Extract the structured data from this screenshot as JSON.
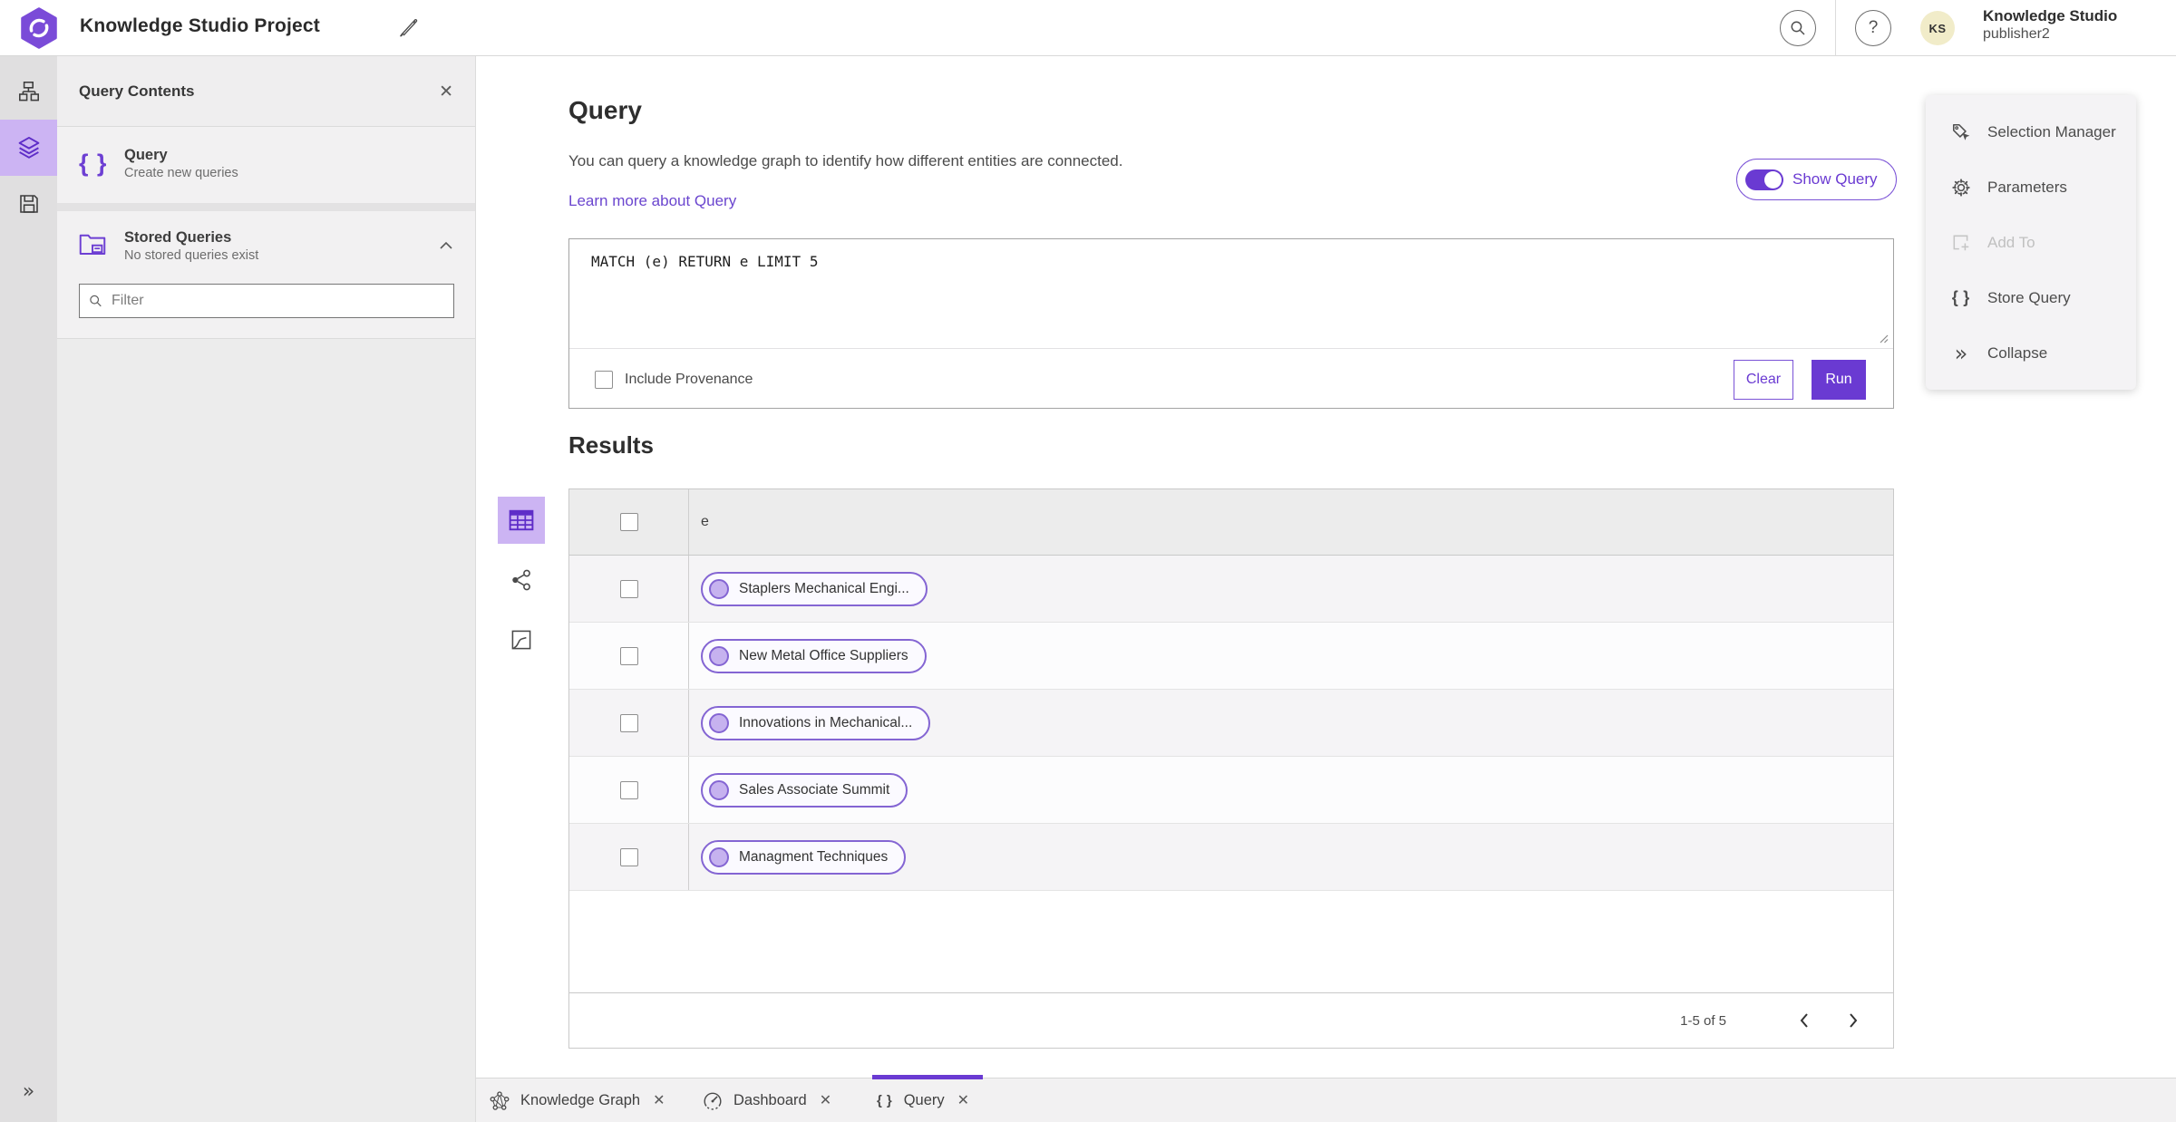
{
  "header": {
    "title": "Knowledge Studio Project",
    "user_name": "Knowledge Studio",
    "user_role": "publisher2",
    "avatar_initials": "KS"
  },
  "rail_icons": [
    "data-model-icon",
    "layers-icon",
    "save-icon",
    "expand-icon"
  ],
  "sidebar": {
    "title": "Query Contents",
    "close_icon": "close-icon",
    "items": [
      {
        "label": "Query",
        "description": "Create new queries",
        "icon": "braces-icon"
      },
      {
        "label": "Stored Queries",
        "description": "No stored queries exist",
        "icon": "stored-folder-icon"
      }
    ],
    "filter_placeholder": "Filter"
  },
  "query": {
    "heading": "Query",
    "description": "You can query a knowledge graph to identify how different entities are connected.",
    "learn_more": "Learn more about Query",
    "show_query_label": "Show Query",
    "show_query_on": true,
    "query_text": "MATCH (e) RETURN e LIMIT 5",
    "include_provenance_label": "Include Provenance",
    "clear_label": "Clear",
    "run_label": "Run"
  },
  "results": {
    "heading": "Results",
    "column_header": "e",
    "view_icons": [
      "table-view-icon",
      "link-chart-view-icon",
      "map-view-icon"
    ],
    "rows": [
      "Staplers Mechanical Engi...",
      "New Metal Office Suppliers",
      "Innovations in Mechanical...",
      "Sales Associate Summit",
      "Managment Techniques"
    ],
    "pagination": {
      "label": "1-5 of 5",
      "prev_icon": "chevron-left-icon",
      "next_icon": "chevron-right-icon"
    }
  },
  "tools_panel": {
    "items": [
      {
        "label": "Selection Manager",
        "icon": "selection-manager-icon",
        "disabled": false
      },
      {
        "label": "Parameters",
        "icon": "gear-icon",
        "disabled": false
      },
      {
        "label": "Add To",
        "icon": "add-to-icon",
        "disabled": true
      },
      {
        "label": "Store Query",
        "icon": "braces-icon",
        "disabled": false
      },
      {
        "label": "Collapse",
        "icon": "double-chevron-right-icon",
        "disabled": false
      }
    ]
  },
  "tabs": [
    {
      "label": "Knowledge Graph",
      "icon": "knowledge-graph-icon",
      "active": false
    },
    {
      "label": "Dashboard",
      "icon": "dashboard-icon",
      "active": false
    },
    {
      "label": "Query",
      "icon": "braces-icon",
      "active": true
    }
  ],
  "colors": {
    "accent_purple": "#6a3ad2",
    "pill_border": "#8465d3",
    "pill_dot_fill": "#c6b2ef",
    "active_highlight": "#ccb4f3",
    "avatar_bg": "#f1ecc9",
    "link": "#6b46cf"
  }
}
